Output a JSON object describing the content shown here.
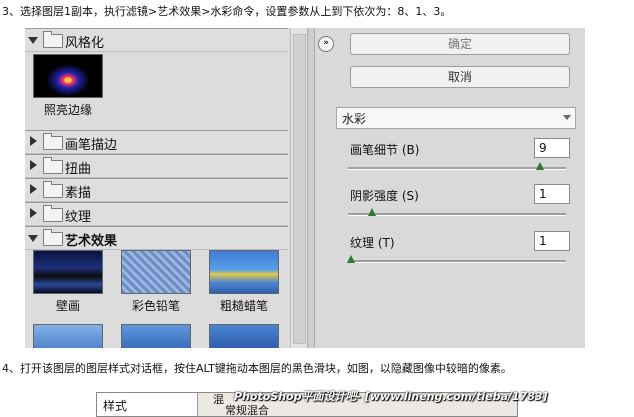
{
  "instructions": {
    "step3": "3、选择图层1副本，执行滤镜>艺术效果>水彩命令，设置参数从上到下依次为：8、1、3。",
    "step4": "4、打开该图层的图层样式对话框，按住ALT键拖动本图层的黑色滑块，如图，以隐藏图像中较暗的像素。"
  },
  "filter_gallery": {
    "stylize": {
      "label": "风格化",
      "thumb_caption": "照亮边缘"
    },
    "collapsed_categories": [
      "画笔描边",
      "扭曲",
      "素描",
      "纹理"
    ],
    "artistic": {
      "label": "艺术效果",
      "thumb_captions": [
        "壁画",
        "彩色铅笔",
        "粗糙蜡笔"
      ]
    }
  },
  "buttons": {
    "ok": "确定",
    "cancel": "取消",
    "collapse_glyph": "»"
  },
  "filter_select": {
    "value": "水彩"
  },
  "params": [
    {
      "label": "画笔细节 (B)",
      "value": "9",
      "fraction": 0.9
    },
    {
      "label": "阴影强度 (S)",
      "value": "1",
      "fraction": 0.1
    },
    {
      "label": "纹理 (T)",
      "value": "1",
      "fraction": 0.0
    }
  ],
  "style_dialog": {
    "tab_label": "样式",
    "group_label": "常规混合",
    "partial_label": "混"
  },
  "watermark": "PhotoShop平面设计吧- [www.lineng.com/tieba/1783]"
}
